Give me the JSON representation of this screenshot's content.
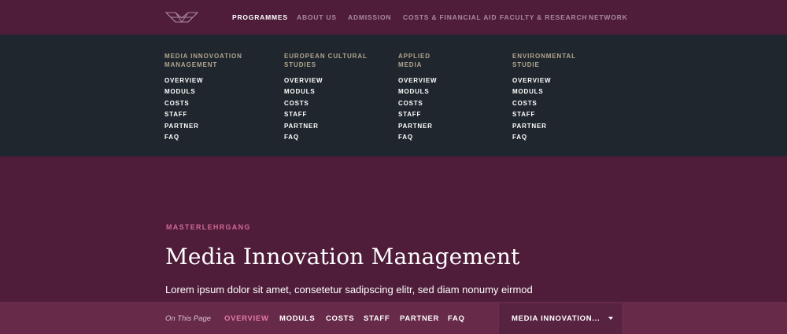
{
  "nav": {
    "items": [
      {
        "label": "PROGRAMMES",
        "active": true
      },
      {
        "label": "ABOUT US",
        "active": false
      },
      {
        "label": "ADMISSION",
        "active": false
      },
      {
        "label": "COSTS & FINANCIAL AID",
        "active": false
      },
      {
        "label": "FACULTY & RESEARCH",
        "active": false
      },
      {
        "label": "NETWORK",
        "active": false
      }
    ]
  },
  "dropdown": {
    "columns": [
      {
        "title": "MEDIA INNOVOATION\nMANAGEMENT",
        "links": [
          "OVERVIEW",
          "MODULS",
          "COSTS",
          "STAFF",
          "PARTNER",
          "FAQ"
        ]
      },
      {
        "title": "EUROPEAN CULTURAL\nSTUDIES",
        "links": [
          "OVERVIEW",
          "MODULS",
          "COSTS",
          "STAFF",
          "PARTNER",
          "FAQ"
        ]
      },
      {
        "title": "APPLIED\nMEDIA",
        "links": [
          "OVERVIEW",
          "MODULS",
          "COSTS",
          "STAFF",
          "PARTNER",
          "FAQ"
        ]
      },
      {
        "title": "ENVIRONMENTAL\nSTUDIE",
        "links": [
          "OVERVIEW",
          "MODULS",
          "COSTS",
          "STAFF",
          "PARTNER",
          "FAQ"
        ]
      }
    ]
  },
  "hero": {
    "kicker": "MASTERLEHRGANG",
    "title": "Media Innovation Management",
    "subtitle": "Lorem ipsum dolor sit amet, consetetur sadipscing elitr, sed diam nonumy eirmod"
  },
  "subnav": {
    "on_page_label": "On This Page",
    "links": [
      {
        "label": "OVERVIEW",
        "active": true
      },
      {
        "label": "MODULS",
        "active": false
      },
      {
        "label": "COSTS",
        "active": false
      },
      {
        "label": "STAFF",
        "active": false
      },
      {
        "label": "PARTNER",
        "active": false
      },
      {
        "label": "FAQ",
        "active": false
      }
    ],
    "programme_select": "MEDIA INNOVATION..."
  },
  "colors": {
    "background": "#4f1d3a",
    "dropdown_bg": "#1f262d",
    "subbar_bg": "#672a48",
    "accent_pink": "#e47aa3",
    "column_title": "#b2a58f"
  },
  "icons": {
    "logo": "geometric-wireframe-logo",
    "select_caret": "caret-down-icon"
  }
}
